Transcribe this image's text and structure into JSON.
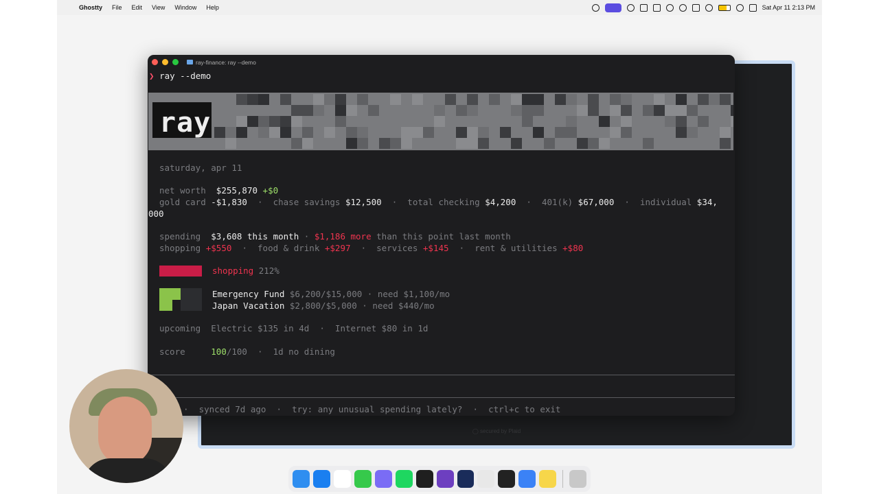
{
  "menubar": {
    "app_name": "Ghostty",
    "items": [
      "File",
      "Edit",
      "View",
      "Window",
      "Help"
    ],
    "datetime": "Sat Apr 11  2:13 PM",
    "status_icons": [
      "record-icon",
      "screen-share-icon",
      "sync-icon",
      "stats-icon",
      "dropbox-icon",
      "focus-icon",
      "moon-icon",
      "mute-icon",
      "account-icon",
      "battery-icon",
      "wifi-icon",
      "control-center-icon"
    ]
  },
  "terminal": {
    "window_title": "ray-finance: ray --demo",
    "prompt_symbol": "❯",
    "command": "ray --demo",
    "logo": "ray",
    "date": "saturday, apr 11",
    "net_worth": {
      "label": "net worth",
      "value": "$255,870",
      "change": "+$0"
    },
    "accounts": [
      {
        "name": "gold card",
        "value": "-$1,830"
      },
      {
        "name": "chase savings",
        "value": "$12,500"
      },
      {
        "name": "total checking",
        "value": "$4,200"
      },
      {
        "name": "401(k)",
        "value": "$67,000"
      },
      {
        "name": "individual",
        "value": "$34,"
      }
    ],
    "accounts_wrap": "000",
    "spending": {
      "label": "spending",
      "amount": "$3,608 this month",
      "sep": "·",
      "delta": "$1,186 more",
      "suffix": "than this point last month"
    },
    "categories": [
      {
        "name": "shopping",
        "value": "+$550"
      },
      {
        "name": "food & drink",
        "value": "+$297"
      },
      {
        "name": "services",
        "value": "+$145"
      },
      {
        "name": "rent & utilities",
        "value": "+$80"
      }
    ],
    "budget_alert": {
      "name": "shopping",
      "pct": "212%"
    },
    "goals": [
      {
        "name": "Emergency Fund",
        "progress": "$6,200/$15,000",
        "need": "need $1,100/mo"
      },
      {
        "name": "Japan Vacation",
        "progress": "$2,800/$5,000",
        "need": "need $440/mo"
      }
    ],
    "upcoming": {
      "label": "upcoming",
      "items": [
        "Electric $135 in 4d",
        "Internet $80 in 1d"
      ]
    },
    "score": {
      "label": "score",
      "value": "100",
      "max": "/100",
      "streak": "1d no dining"
    },
    "status_line": {
      "synced": "synced 7d ago",
      "hint": "try: any unusual spending lately?",
      "exit": "ctrl+c to exit"
    }
  },
  "back_window_footer": "◯ secured by Plaid",
  "dock": {
    "apps": [
      "finder-icon",
      "app-store-icon",
      "calendar-icon",
      "messages-icon",
      "xcode-icon",
      "spotify-icon",
      "chatgpt-icon",
      "obsidian-icon",
      "terminal-icon",
      "slack-icon",
      "ghostty-icon",
      "browser-icon",
      "notes-icon",
      "trash-icon"
    ],
    "colors": [
      "#2f8ef0",
      "#1a7ff0",
      "#ffffff",
      "#36c94b",
      "#7a6cf5",
      "#1ed760",
      "#1f1f1f",
      "#6d3fc0",
      "#1a2c5a",
      "#e8e8e8",
      "#222222",
      "#3b82f6",
      "#f7d64a",
      "#c8c8c8"
    ]
  }
}
